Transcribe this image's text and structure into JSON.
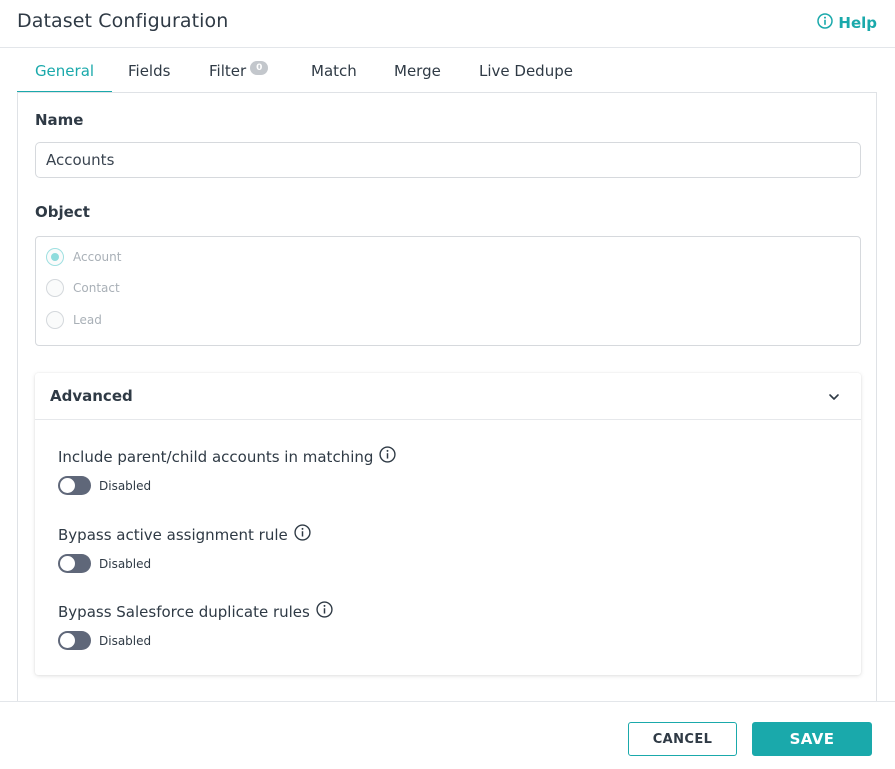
{
  "header": {
    "title": "Dataset Configuration",
    "help_label": "Help"
  },
  "tabs": [
    {
      "label": "General",
      "active": true
    },
    {
      "label": "Fields"
    },
    {
      "label": "Filter",
      "badge": "0"
    },
    {
      "label": "Match"
    },
    {
      "label": "Merge"
    },
    {
      "label": "Live Dedupe"
    }
  ],
  "general": {
    "name_label": "Name",
    "name_value": "Accounts",
    "object_label": "Object",
    "object_options": [
      {
        "label": "Account",
        "selected": true
      },
      {
        "label": "Contact",
        "selected": false
      },
      {
        "label": "Lead",
        "selected": false
      }
    ]
  },
  "advanced": {
    "title": "Advanced",
    "options": [
      {
        "label": "Include parent/child accounts in matching",
        "status": "Disabled"
      },
      {
        "label": "Bypass active assignment rule",
        "status": "Disabled"
      },
      {
        "label": "Bypass Salesforce duplicate rules",
        "status": "Disabled"
      }
    ]
  },
  "footer": {
    "cancel_label": "CANCEL",
    "save_label": "SAVE"
  },
  "colors": {
    "accent": "#1aa9ab",
    "toggle_off": "#5f6779"
  },
  "icons": [
    "info-icon",
    "chevron-down-icon"
  ]
}
